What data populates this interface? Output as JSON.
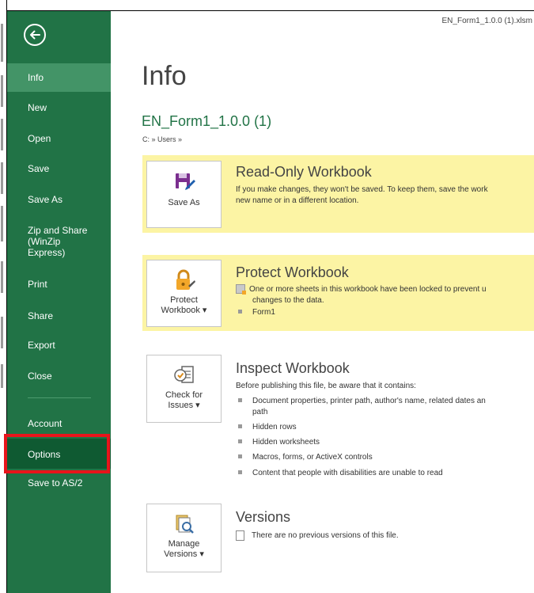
{
  "window": {
    "filename": "EN_Form1_1.0.0 (1).xlsm"
  },
  "sidebar": {
    "back_icon": "back-arrow-icon",
    "items": [
      {
        "label": "Info"
      },
      {
        "label": "New"
      },
      {
        "label": "Open"
      },
      {
        "label": "Save"
      },
      {
        "label": "Save As"
      },
      {
        "label": "Zip and Share\n(WinZip\nExpress)"
      },
      {
        "label": "Print"
      },
      {
        "label": "Share"
      },
      {
        "label": "Export"
      },
      {
        "label": "Close"
      },
      {
        "label": "Account"
      },
      {
        "label": "Options"
      },
      {
        "label": "Save to AS/2"
      }
    ]
  },
  "main": {
    "title": "Info",
    "doc_title": "EN_Form1_1.0.0 (1)",
    "doc_path": "C: » Users »",
    "readonly": {
      "button_label": "Save As",
      "icon": "save-as-icon",
      "title": "Read-Only Workbook",
      "text_line1": "If you make changes, they won't be saved. To keep them, save the work",
      "text_line2": "new name or in a different location."
    },
    "protect": {
      "button_label_1": "Protect",
      "button_label_2": "Workbook ▾",
      "icon": "lock-icon",
      "title": "Protect Workbook",
      "text_line1": "One or more sheets in this workbook have been locked to prevent u",
      "text_line2": "changes to the data.",
      "bullet": "Form1"
    },
    "inspect": {
      "button_label_1": "Check for",
      "button_label_2": "Issues ▾",
      "icon": "inspect-document-icon",
      "title": "Inspect Workbook",
      "intro": "Before publishing this file, be aware that it contains:",
      "bullets": [
        "Document properties, printer path, author's name, related dates an",
        "path",
        "Hidden rows",
        "Hidden worksheets",
        "Macros, forms, or ActiveX controls",
        "Content that people with disabilities are unable to read"
      ]
    },
    "versions": {
      "button_label_1": "Manage",
      "button_label_2": "Versions ▾",
      "icon": "manage-versions-icon",
      "title": "Versions",
      "text": "There are no previous versions of this file."
    }
  },
  "colors": {
    "sidebar": "#217346",
    "active": "#439467",
    "selected": "#0f5a32",
    "highlight": "#e8141b",
    "panel": "#fcf4a4"
  }
}
